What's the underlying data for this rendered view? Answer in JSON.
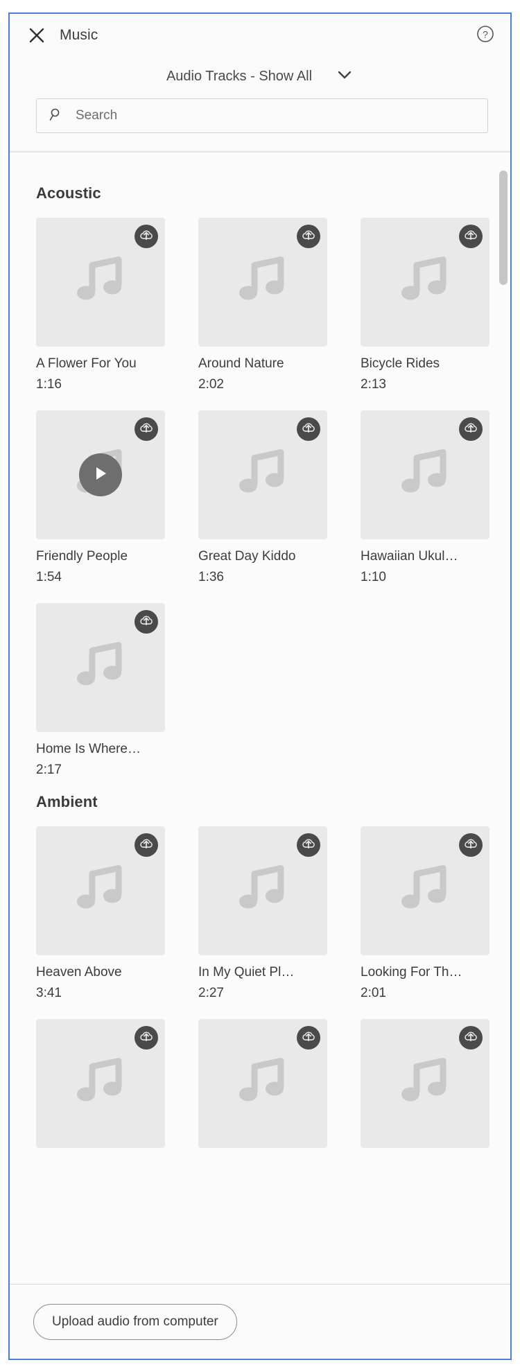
{
  "panel": {
    "title": "Music",
    "close_icon": "close-icon",
    "help_icon": "help-circle-icon"
  },
  "filter": {
    "selected": "Audio Tracks - Show All",
    "chevron_icon": "chevron-down-icon"
  },
  "search": {
    "placeholder": "Search",
    "value": "",
    "icon": "search-icon"
  },
  "sections": [
    {
      "title": "Acoustic",
      "tracks": [
        {
          "title": "A Flower For You",
          "duration": "1:16",
          "badge_icon": "cloud-upload-icon",
          "playing": false,
          "thumb_icon": "music-note-icon"
        },
        {
          "title": "Around Nature",
          "duration": "2:02",
          "badge_icon": "cloud-upload-icon",
          "playing": false,
          "thumb_icon": "music-note-icon"
        },
        {
          "title": "Bicycle Rides",
          "duration": "2:13",
          "badge_icon": "cloud-upload-icon",
          "playing": false,
          "thumb_icon": "music-note-icon"
        },
        {
          "title": "Friendly People",
          "duration": "1:54",
          "badge_icon": "cloud-upload-icon",
          "playing": true,
          "thumb_icon": "music-note-icon"
        },
        {
          "title": "Great Day Kiddo",
          "duration": "1:36",
          "badge_icon": "cloud-upload-icon",
          "playing": false,
          "thumb_icon": "music-note-icon"
        },
        {
          "title": "Hawaiian Ukul…",
          "duration": "1:10",
          "badge_icon": "cloud-upload-icon",
          "playing": false,
          "thumb_icon": "music-note-icon"
        },
        {
          "title": "Home Is Where…",
          "duration": "2:17",
          "badge_icon": "cloud-upload-icon",
          "playing": false,
          "thumb_icon": "music-note-icon"
        }
      ]
    },
    {
      "title": "Ambient",
      "tracks": [
        {
          "title": "Heaven Above",
          "duration": "3:41",
          "badge_icon": "cloud-upload-icon",
          "playing": false,
          "thumb_icon": "music-note-icon"
        },
        {
          "title": "In My Quiet Pl…",
          "duration": "2:27",
          "badge_icon": "cloud-upload-icon",
          "playing": false,
          "thumb_icon": "music-note-icon"
        },
        {
          "title": "Looking For Th…",
          "duration": "2:01",
          "badge_icon": "cloud-upload-icon",
          "playing": false,
          "thumb_icon": "music-note-icon"
        },
        {
          "title": "",
          "duration": "",
          "badge_icon": "cloud-upload-icon",
          "playing": false,
          "thumb_icon": "music-note-icon"
        },
        {
          "title": "",
          "duration": "",
          "badge_icon": "cloud-upload-icon",
          "playing": false,
          "thumb_icon": "music-note-icon"
        },
        {
          "title": "",
          "duration": "",
          "badge_icon": "cloud-upload-icon",
          "playing": false,
          "thumb_icon": "music-note-icon"
        }
      ]
    }
  ],
  "footer": {
    "upload_label": "Upload audio from computer"
  },
  "colors": {
    "focus_border": "#4a7fd4",
    "panel_bg": "#fafafa",
    "thumb_bg": "#e9e9e9",
    "badge_bg": "#4a4a4a",
    "text": "#3c3c3c",
    "scrollbar": "#c6c6c6"
  }
}
